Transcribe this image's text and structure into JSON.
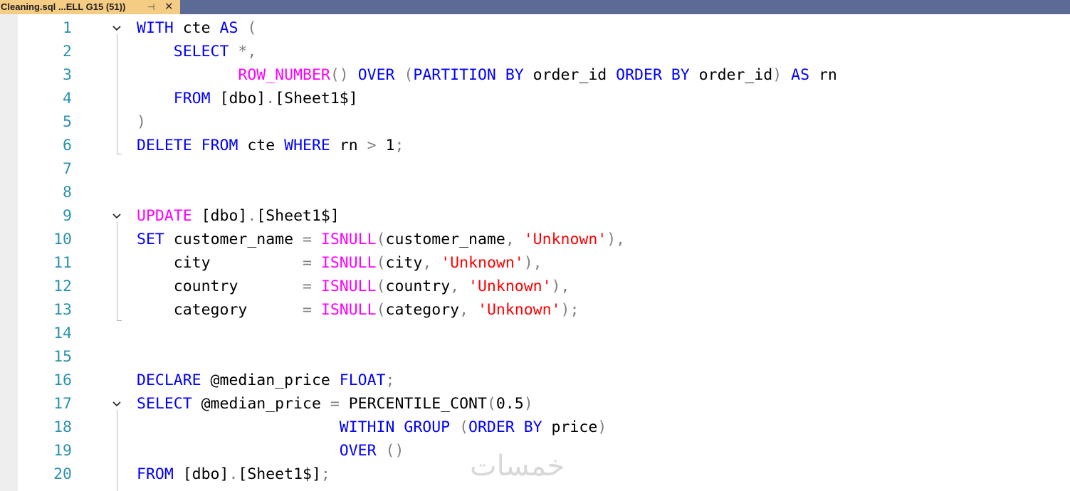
{
  "tab": {
    "title": "Cleaning.sql ...ELL G15 (51))",
    "pin_icon": "pin-icon",
    "close_icon": "close-icon"
  },
  "editor": {
    "lines": [
      {
        "num": "1",
        "fold": true,
        "tokens": [
          [
            "kw",
            "WITH"
          ],
          [
            "t",
            " cte "
          ],
          [
            "kw",
            "AS"
          ],
          [
            "t",
            " "
          ],
          [
            "op",
            "("
          ]
        ]
      },
      {
        "num": "2",
        "fold": false,
        "tokens": [
          [
            "t",
            "    "
          ],
          [
            "kw",
            "SELECT"
          ],
          [
            "t",
            " "
          ],
          [
            "op",
            "*,"
          ]
        ]
      },
      {
        "num": "3",
        "fold": false,
        "tokens": [
          [
            "t",
            "           "
          ],
          [
            "fn",
            "ROW_NUMBER"
          ],
          [
            "op",
            "()"
          ],
          [
            "t",
            " "
          ],
          [
            "kw",
            "OVER"
          ],
          [
            "t",
            " "
          ],
          [
            "op",
            "("
          ],
          [
            "kw",
            "PARTITION BY"
          ],
          [
            "t",
            " order_id "
          ],
          [
            "kw",
            "ORDER BY"
          ],
          [
            "t",
            " order_id"
          ],
          [
            "op",
            ")"
          ],
          [
            "t",
            " "
          ],
          [
            "kw",
            "AS"
          ],
          [
            "t",
            " rn"
          ]
        ]
      },
      {
        "num": "4",
        "fold": false,
        "tokens": [
          [
            "t",
            "    "
          ],
          [
            "kw",
            "FROM"
          ],
          [
            "t",
            " [dbo]"
          ],
          [
            "op",
            "."
          ],
          [
            "t",
            "[Sheet1$]"
          ]
        ]
      },
      {
        "num": "5",
        "fold": false,
        "tokens": [
          [
            "op",
            ")"
          ]
        ]
      },
      {
        "num": "6",
        "fold": false,
        "tokens": [
          [
            "kw",
            "DELETE"
          ],
          [
            "t",
            " "
          ],
          [
            "kw",
            "FROM"
          ],
          [
            "t",
            " cte "
          ],
          [
            "kw",
            "WHERE"
          ],
          [
            "t",
            " rn "
          ],
          [
            "op",
            ">"
          ],
          [
            "t",
            " 1"
          ],
          [
            "op",
            ";"
          ]
        ]
      },
      {
        "num": "7",
        "fold": false,
        "tokens": []
      },
      {
        "num": "8",
        "fold": false,
        "tokens": []
      },
      {
        "num": "9",
        "fold": true,
        "tokens": [
          [
            "fn",
            "UPDATE"
          ],
          [
            "t",
            " [dbo]"
          ],
          [
            "op",
            "."
          ],
          [
            "t",
            "[Sheet1$]"
          ]
        ]
      },
      {
        "num": "10",
        "fold": false,
        "tokens": [
          [
            "kw",
            "SET"
          ],
          [
            "t",
            " customer_name "
          ],
          [
            "op",
            "="
          ],
          [
            "t",
            " "
          ],
          [
            "fn",
            "ISNULL"
          ],
          [
            "op",
            "("
          ],
          [
            "t",
            "customer_name"
          ],
          [
            "op",
            ","
          ],
          [
            "t",
            " "
          ],
          [
            "str",
            "'Unknown'"
          ],
          [
            "op",
            "),"
          ]
        ]
      },
      {
        "num": "11",
        "fold": false,
        "tokens": [
          [
            "t",
            "    city          "
          ],
          [
            "op",
            "="
          ],
          [
            "t",
            " "
          ],
          [
            "fn",
            "ISNULL"
          ],
          [
            "op",
            "("
          ],
          [
            "t",
            "city"
          ],
          [
            "op",
            ","
          ],
          [
            "t",
            " "
          ],
          [
            "str",
            "'Unknown'"
          ],
          [
            "op",
            "),"
          ]
        ]
      },
      {
        "num": "12",
        "fold": false,
        "tokens": [
          [
            "t",
            "    country       "
          ],
          [
            "op",
            "="
          ],
          [
            "t",
            " "
          ],
          [
            "fn",
            "ISNULL"
          ],
          [
            "op",
            "("
          ],
          [
            "t",
            "country"
          ],
          [
            "op",
            ","
          ],
          [
            "t",
            " "
          ],
          [
            "str",
            "'Unknown'"
          ],
          [
            "op",
            "),"
          ]
        ]
      },
      {
        "num": "13",
        "fold": false,
        "tokens": [
          [
            "t",
            "    category      "
          ],
          [
            "op",
            "="
          ],
          [
            "t",
            " "
          ],
          [
            "fn",
            "ISNULL"
          ],
          [
            "op",
            "("
          ],
          [
            "t",
            "category"
          ],
          [
            "op",
            ","
          ],
          [
            "t",
            " "
          ],
          [
            "str",
            "'Unknown'"
          ],
          [
            "op",
            ");"
          ]
        ]
      },
      {
        "num": "14",
        "fold": false,
        "tokens": []
      },
      {
        "num": "15",
        "fold": false,
        "tokens": []
      },
      {
        "num": "16",
        "fold": false,
        "tokens": [
          [
            "kw",
            "DECLARE"
          ],
          [
            "t",
            " @median_price "
          ],
          [
            "kw",
            "FLOAT"
          ],
          [
            "op",
            ";"
          ]
        ]
      },
      {
        "num": "17",
        "fold": true,
        "tokens": [
          [
            "kw",
            "SELECT"
          ],
          [
            "t",
            " @median_price "
          ],
          [
            "op",
            "="
          ],
          [
            "t",
            " PERCENTILE_CONT"
          ],
          [
            "op",
            "("
          ],
          [
            "t",
            "0.5"
          ],
          [
            "op",
            ")"
          ]
        ]
      },
      {
        "num": "18",
        "fold": false,
        "tokens": [
          [
            "t",
            "                      "
          ],
          [
            "kw",
            "WITHIN GROUP"
          ],
          [
            "t",
            " "
          ],
          [
            "op",
            "("
          ],
          [
            "kw",
            "ORDER BY"
          ],
          [
            "t",
            " price"
          ],
          [
            "op",
            ")"
          ]
        ]
      },
      {
        "num": "19",
        "fold": false,
        "tokens": [
          [
            "t",
            "                      "
          ],
          [
            "kw",
            "OVER"
          ],
          [
            "t",
            " "
          ],
          [
            "op",
            "()"
          ]
        ]
      },
      {
        "num": "20",
        "fold": false,
        "tokens": [
          [
            "kw",
            "FROM"
          ],
          [
            "t",
            " [dbo]"
          ],
          [
            "op",
            "."
          ],
          [
            "t",
            "[Sheet1$]"
          ],
          [
            "op",
            ";"
          ]
        ]
      }
    ]
  },
  "watermark": "خمسات",
  "colors": {
    "keyword": "#0000ff",
    "function": "#ff00ff",
    "string": "#ff0000",
    "operator": "#808080",
    "line_number": "#2b91af",
    "tab_active": "#f5cc84",
    "tabstrip": "#5c6b95"
  }
}
